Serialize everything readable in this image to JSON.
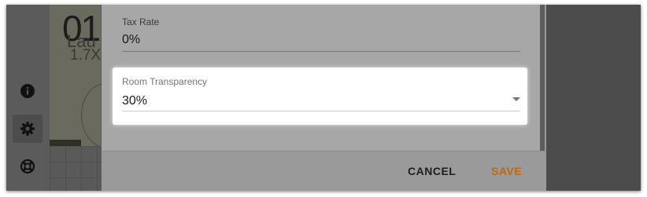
{
  "rail": {
    "icons": [
      "info-icon",
      "gear-icon",
      "lifebuoy-icon"
    ]
  },
  "floorplan": {
    "number": "01",
    "room_name": "Lau",
    "scale": "1.7X"
  },
  "dialog": {
    "tax_rate": {
      "label": "Tax Rate",
      "value": "0%"
    },
    "room_transparency": {
      "label": "Room Transparency",
      "value": "30%"
    },
    "actions": {
      "cancel": "CANCEL",
      "save": "SAVE"
    }
  },
  "colors": {
    "accent": "#c5660a",
    "icon_dark": "#1b1b1b"
  }
}
